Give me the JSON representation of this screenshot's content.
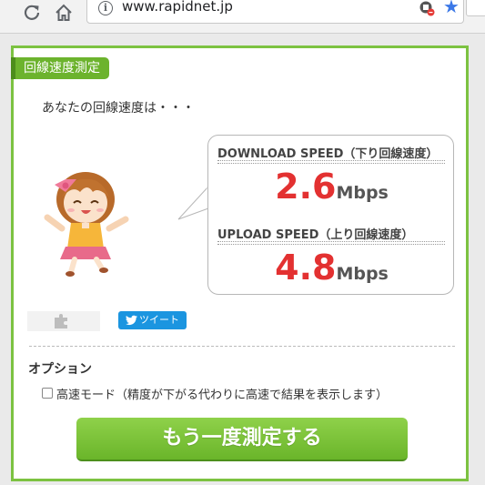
{
  "browser": {
    "url": "www.rapidnet.jp",
    "icons": {
      "reload": "reload-icon",
      "home": "home-icon",
      "info": "info-icon",
      "extension": "extension-icon",
      "bookmark": "star-icon"
    }
  },
  "section": {
    "title": "回線速度測定"
  },
  "result": {
    "question": "あなたの回線速度は・・・",
    "download": {
      "label": "DOWNLOAD SPEED（下り回線速度）",
      "value": "2.6",
      "unit": "Mbps"
    },
    "upload": {
      "label": "UPLOAD SPEED（上り回線速度）",
      "value": "4.8",
      "unit": "Mbps"
    }
  },
  "share": {
    "tweet_label": "ツイート"
  },
  "options": {
    "title": "オプション",
    "fast_mode_label": "高速モード（精度が下がる代わりに高速で結果を表示します）",
    "fast_mode_checked": false
  },
  "actions": {
    "retry_label": "もう一度測定する"
  },
  "colors": {
    "accent_green": "#6cb32d",
    "speed_red": "#e33131",
    "tweet_blue": "#1b95e0"
  }
}
